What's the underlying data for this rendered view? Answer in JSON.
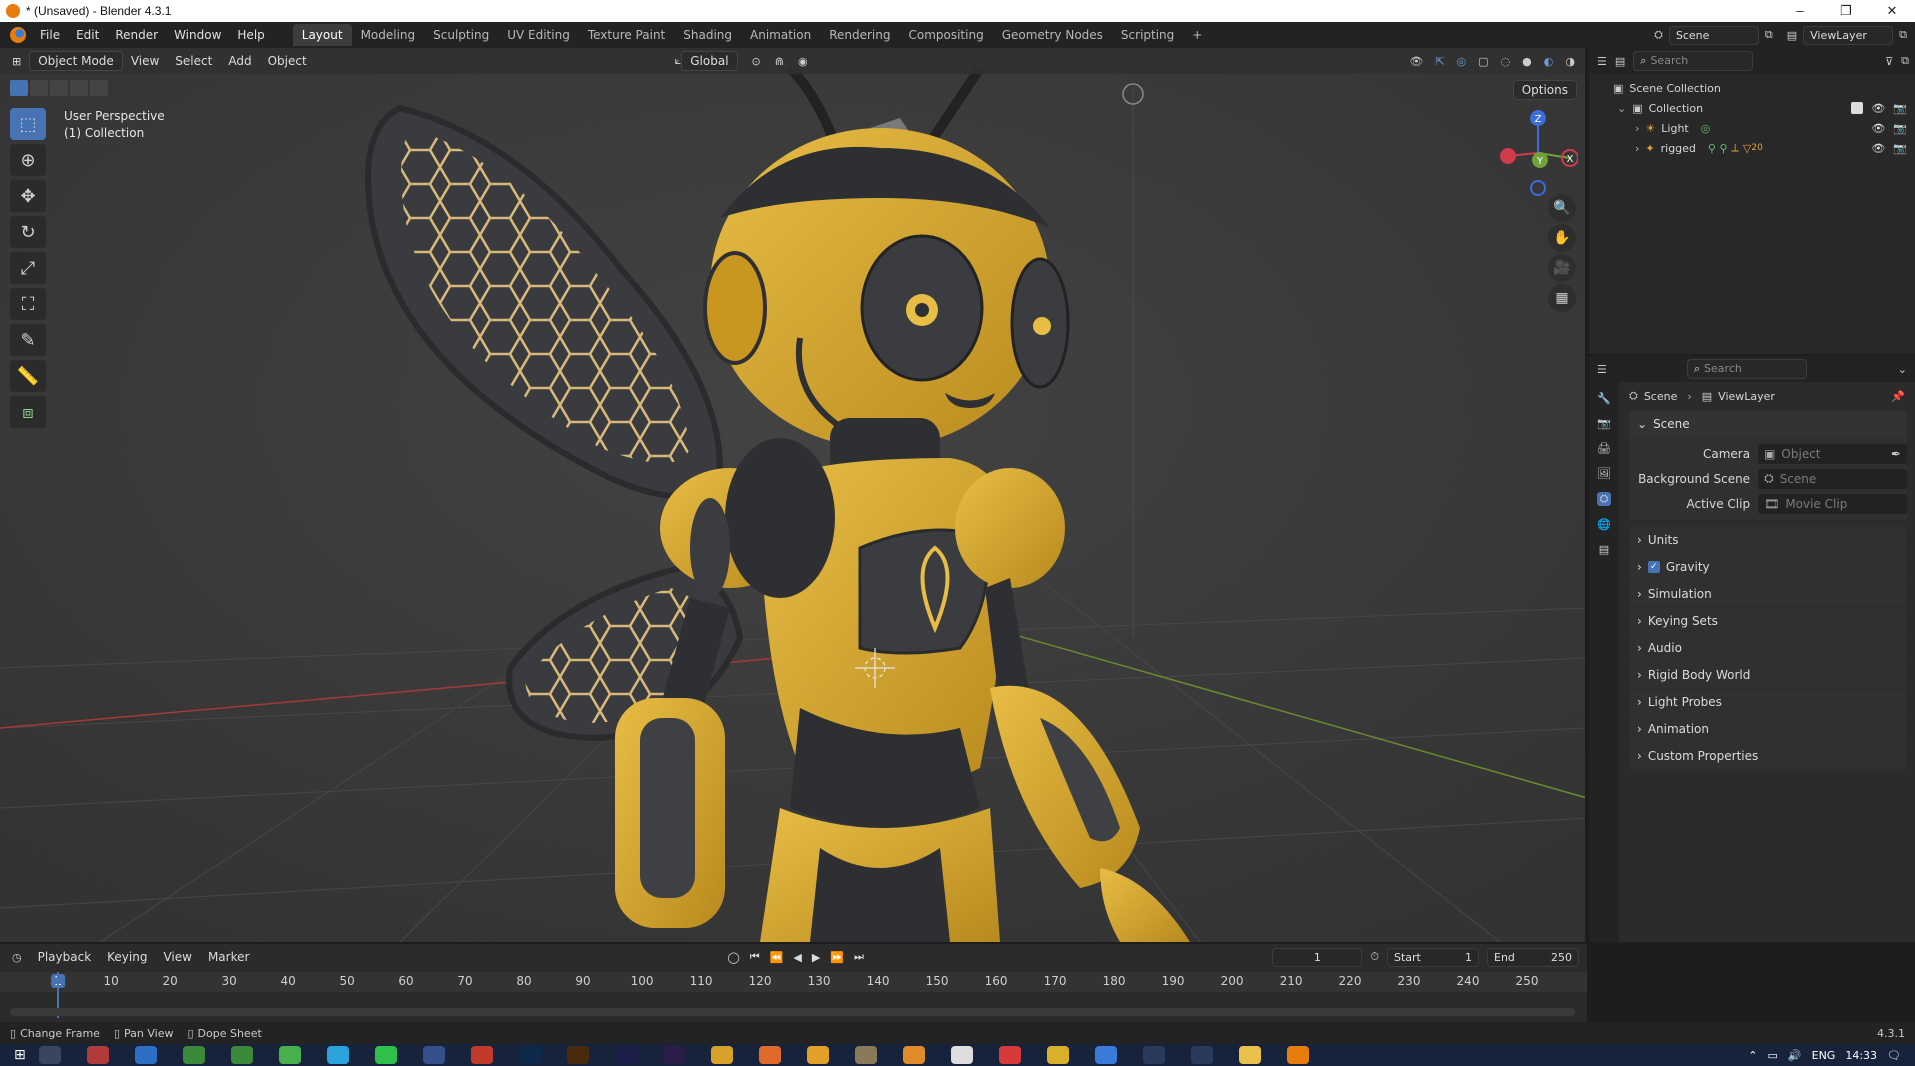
{
  "window": {
    "title": "* (Unsaved) - Blender 4.3.1",
    "controls": [
      "–",
      "❐",
      "✕"
    ]
  },
  "menubar": {
    "menus": [
      "File",
      "Edit",
      "Render",
      "Window",
      "Help"
    ],
    "workspaces": [
      "Layout",
      "Modeling",
      "Sculpting",
      "UV Editing",
      "Texture Paint",
      "Shading",
      "Animation",
      "Rendering",
      "Compositing",
      "Geometry Nodes",
      "Scripting"
    ],
    "active_workspace": "Layout",
    "add_tab": "+",
    "scene": "Scene",
    "view_layer": "ViewLayer"
  },
  "viewport_header": {
    "mode": "Object Mode",
    "menus": [
      "View",
      "Select",
      "Add",
      "Object"
    ],
    "orientation": "Global",
    "options": "Options"
  },
  "viewport": {
    "overlay_line1": "User Perspective",
    "overlay_line2": "(1) Collection",
    "gizmo_axes": [
      "Z",
      "Y",
      "X"
    ]
  },
  "outliner": {
    "search_placeholder": "Search",
    "root": "Scene Collection",
    "collection": "Collection",
    "items": [
      {
        "name": "Light"
      },
      {
        "name": "rigged",
        "badge": "20"
      }
    ]
  },
  "properties": {
    "search_placeholder": "Search",
    "breadcrumb": [
      "Scene",
      "ViewLayer"
    ],
    "section": "Scene",
    "fields": [
      {
        "label": "Camera",
        "placeholder": "Object"
      },
      {
        "label": "Background Scene",
        "placeholder": "Scene"
      },
      {
        "label": "Active Clip",
        "placeholder": "Movie Clip"
      }
    ],
    "panels": [
      "Units",
      "Gravity",
      "Simulation",
      "Keying Sets",
      "Audio",
      "Rigid Body World",
      "Light Probes",
      "Animation",
      "Custom Properties"
    ],
    "gravity_checked": true
  },
  "timeline": {
    "menus": [
      "Playback",
      "Keying",
      "View",
      "Marker"
    ],
    "current_frame": "1",
    "start_label": "Start",
    "start_value": "1",
    "end_label": "End",
    "end_value": "250",
    "ticks": [
      "1",
      "10",
      "20",
      "30",
      "40",
      "50",
      "60",
      "70",
      "80",
      "90",
      "100",
      "110",
      "120",
      "130",
      "140",
      "150",
      "160",
      "170",
      "180",
      "190",
      "200",
      "210",
      "220",
      "230",
      "240",
      "250"
    ]
  },
  "statusbar": {
    "items": [
      "Change Frame",
      "Pan View",
      "Dope Sheet"
    ],
    "version": "4.3.1"
  },
  "taskbar": {
    "language": "ENG",
    "time": "14:33"
  },
  "colors": {
    "accent": "#4772b3",
    "bee_yellow": "#d9a931",
    "bee_dark": "#2e2f32",
    "orange": "#e87d0d"
  }
}
